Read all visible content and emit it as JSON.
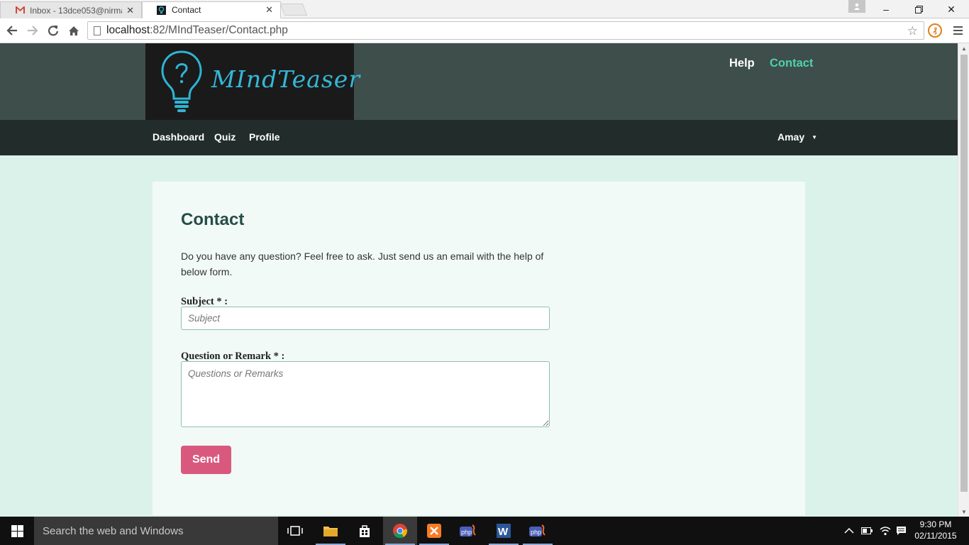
{
  "browser": {
    "tabs": [
      {
        "title": "Inbox - 13dce053@nirma",
        "active": false
      },
      {
        "title": "Contact",
        "active": true
      }
    ],
    "url_host": "localhost",
    "url_path": ":82/MIndTeaser/Contact.php"
  },
  "site": {
    "logo_text": "MIndTeaser",
    "top_links": {
      "help": "Help",
      "contact": "Contact"
    },
    "nav": {
      "dashboard": "Dashboard",
      "quiz": "Quiz",
      "profile": "Profile"
    },
    "user": "Amay"
  },
  "contact": {
    "heading": "Contact",
    "intro": "Do you have any question? Feel free to ask. Just send us an email with the help of below form.",
    "subject_label": "Subject * :",
    "subject_placeholder": "Subject",
    "subject_value": "",
    "question_label": "Question or Remark * :",
    "question_placeholder": "Questions or Remarks",
    "question_value": "",
    "send_label": "Send"
  },
  "taskbar": {
    "search_placeholder": "Search the web and Windows",
    "time": "9:30 PM",
    "date": "02/11/2015"
  },
  "colors": {
    "header_bg": "#3d4e4b",
    "nav_bg": "#222d2b",
    "page_bg": "#dbf2eb",
    "card_bg": "#f2faf8",
    "accent_contact": "#4fd1aa",
    "heading": "#264e46",
    "send_button": "#d9597e",
    "logo_text": "#35b7d6"
  },
  "icons": [
    "gmail-icon",
    "site-favicon",
    "back-icon",
    "forward-icon",
    "reload-icon",
    "home-icon",
    "page-icon",
    "star-icon",
    "extension-icon",
    "chrome-menu-icon",
    "lightbulb-logo-icon",
    "windows-start-icon",
    "task-view-icon",
    "file-explorer-icon",
    "store-icon",
    "chrome-icon",
    "xampp-icon",
    "phpstorm-icon",
    "word-icon"
  ]
}
